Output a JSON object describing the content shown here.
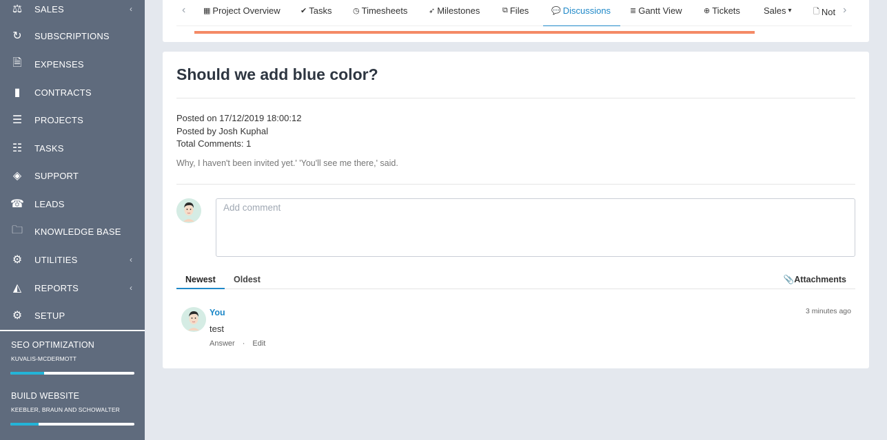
{
  "sidebar": {
    "items": [
      {
        "label": "SALES",
        "icon": "scale-icon",
        "glyph": "⚖",
        "caret": "‹"
      },
      {
        "label": "SUBSCRIPTIONS",
        "icon": "refresh-icon",
        "glyph": "↻",
        "caret": ""
      },
      {
        "label": "EXPENSES",
        "icon": "file-text-icon",
        "glyph": "🗎",
        "caret": ""
      },
      {
        "label": "CONTRACTS",
        "icon": "file-icon",
        "glyph": "▮",
        "caret": ""
      },
      {
        "label": "PROJECTS",
        "icon": "bars-icon",
        "glyph": "☰",
        "caret": ""
      },
      {
        "label": "TASKS",
        "icon": "tasks-icon",
        "glyph": "☷",
        "caret": ""
      },
      {
        "label": "SUPPORT",
        "icon": "ticket-icon",
        "glyph": "◈",
        "caret": ""
      },
      {
        "label": "LEADS",
        "icon": "phone-icon",
        "glyph": "☎",
        "caret": ""
      },
      {
        "label": "KNOWLEDGE BASE",
        "icon": "folder-open-icon",
        "glyph": "🗀",
        "caret": ""
      },
      {
        "label": "UTILITIES",
        "icon": "cogs-icon",
        "glyph": "⚙",
        "caret": "‹"
      },
      {
        "label": "REPORTS",
        "icon": "area-chart-icon",
        "glyph": "◭",
        "caret": "‹"
      },
      {
        "label": "SETUP",
        "icon": "cog-icon",
        "glyph": "⚙",
        "caret": ""
      }
    ],
    "projects": [
      {
        "name": "SEO OPTIMIZATION",
        "client": "KUVALIS-MCDERMOTT",
        "progress": 0.27
      },
      {
        "name": "BUILD WEBSITE",
        "client": "KEEBLER, BRAUN AND SCHOWALTER",
        "progress": 0.23
      }
    ]
  },
  "tabs": {
    "items": [
      {
        "label": "Project Overview",
        "icon": "th-icon",
        "glyph": "▦"
      },
      {
        "label": "Tasks",
        "icon": "check-circle-icon",
        "glyph": "✔"
      },
      {
        "label": "Timesheets",
        "icon": "clock-icon",
        "glyph": "◷"
      },
      {
        "label": "Milestones",
        "icon": "rocket-icon",
        "glyph": "➶"
      },
      {
        "label": "Files",
        "icon": "files-icon",
        "glyph": "⧉"
      },
      {
        "label": "Discussions",
        "icon": "comment-icon",
        "glyph": "💬"
      },
      {
        "label": "Gantt View",
        "icon": "align-left-icon",
        "glyph": "≣"
      },
      {
        "label": "Tickets",
        "icon": "life-ring-icon",
        "glyph": "⊕"
      },
      {
        "label": "Sales",
        "icon": "caret-down-icon",
        "glyph": "▾"
      },
      {
        "label": "Not",
        "icon": "file-o-icon",
        "glyph": "🗋"
      }
    ],
    "active": "Discussions",
    "progress": 0.83
  },
  "discussion": {
    "title": "Should we add blue color?",
    "posted_on": "Posted on 17/12/2019 18:00:12",
    "posted_by": "Posted by Josh Kuphal",
    "total_comments": "Total Comments: 1",
    "description": "Why, I haven't been invited yet.' 'You'll see me there,' said."
  },
  "comment_input": {
    "placeholder": "Add comment",
    "value": ""
  },
  "sort": {
    "newest": "Newest",
    "oldest": "Oldest",
    "active": "Newest"
  },
  "attachments_label": "Attachments",
  "comments": [
    {
      "author": "You",
      "time": "3 minutes ago",
      "text": "test",
      "answer": "Answer",
      "separator": "·",
      "edit": "Edit"
    }
  ],
  "colors": {
    "sidebar": "#5f6b7d",
    "accent": "#1e88c8",
    "progress_tabs": "#f48a66",
    "progress_project": "#23b4d8"
  }
}
